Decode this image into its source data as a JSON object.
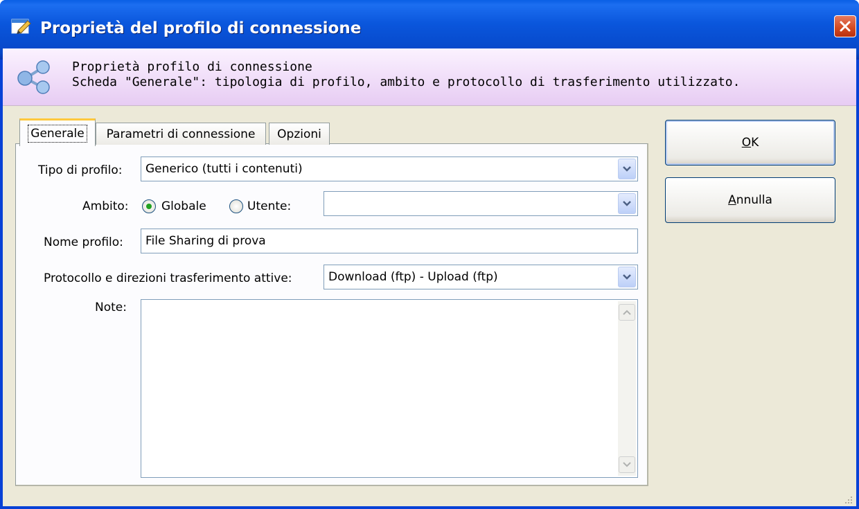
{
  "window": {
    "title": "Proprietà del profilo di connessione",
    "icon": "edit-window-icon",
    "close_icon": "close-icon"
  },
  "header": {
    "icon": "share-icon",
    "line1": "Proprietà profilo di connessione",
    "line2": "Scheda \"Generale\": tipologia di profilo, ambito e protocollo di trasferimento utilizzato."
  },
  "tabs": [
    {
      "label": "Generale",
      "selected": true
    },
    {
      "label": "Parametri di connessione",
      "selected": false
    },
    {
      "label": "Opzioni",
      "selected": false
    }
  ],
  "form": {
    "tipo_label": "Tipo di profilo:",
    "tipo_value": "Generico (tutti i contenuti)",
    "ambito_label": "Ambito:",
    "globale_label": "Globale",
    "utente_label": "Utente:",
    "ambito_selected": "Globale",
    "utente_value": "",
    "nome_label": "Nome profilo:",
    "nome_value": "File Sharing di prova",
    "protocollo_label": "Protocollo e direzioni trasferimento attive:",
    "protocollo_value": "Download (ftp) - Upload (ftp)",
    "note_label": "Note:",
    "note_value": ""
  },
  "buttons": {
    "ok_underline": "O",
    "ok_rest": "K",
    "cancel_underline": "A",
    "cancel_rest": "nnulla"
  },
  "colors": {
    "title_bar": "#0a56dc",
    "header_band_top": "#fbf2ff",
    "header_band_bottom": "#e7ccf3",
    "dialog_bg": "#ece9d8",
    "close_button": "#d2481f",
    "selected_tab_accent": "#ffc83c"
  }
}
